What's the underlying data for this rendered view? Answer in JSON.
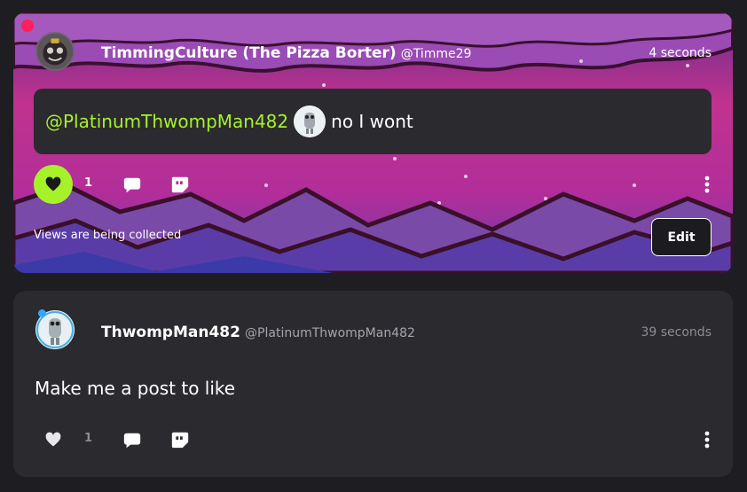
{
  "posts": [
    {
      "author_name": "TimmingCulture (The Pizza Borter)",
      "author_handle": "@Timme29",
      "time": "4 seconds",
      "mention": "@PlatinumThwompMan482",
      "text": "no I wont",
      "likes": "1",
      "liked": true,
      "views_text": "Views are being collected",
      "edit_label": "Edit"
    },
    {
      "author_name": "ThwompMan482",
      "author_handle": "@PlatinumThwompMan482",
      "time": "39 seconds",
      "text": "Make me a post to like",
      "likes": "1",
      "liked": false
    }
  ],
  "icons": {
    "like": "heart-icon",
    "comment": "comment-icon",
    "quote": "quote-icon",
    "more": "more-vertical-icon"
  },
  "colors": {
    "accent": "#a6f22a",
    "card": "#2b2a2f",
    "background": "#1e1d21",
    "notification": "#ff1f5a",
    "presence": "#2fa8ff"
  }
}
